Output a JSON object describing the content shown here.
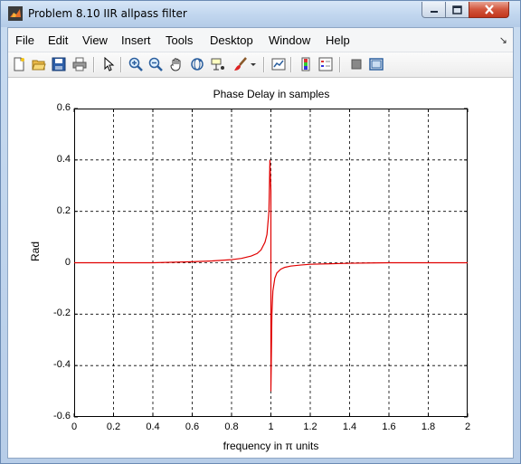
{
  "window": {
    "title": "Problem 8.10 IIR allpass filter"
  },
  "menubar": {
    "items": [
      "File",
      "Edit",
      "View",
      "Insert",
      "Tools",
      "Desktop",
      "Window",
      "Help"
    ],
    "overflow_arrow": "↘"
  },
  "toolbar": {
    "buttons": [
      {
        "name": "new-figure-icon"
      },
      {
        "name": "open-file-icon"
      },
      {
        "name": "save-figure-icon"
      },
      {
        "name": "print-figure-icon"
      },
      {
        "name": "edit-plot-arrow-icon"
      },
      {
        "name": "zoom-in-icon"
      },
      {
        "name": "zoom-out-icon"
      },
      {
        "name": "pan-hand-icon"
      },
      {
        "name": "rotate-3d-icon"
      },
      {
        "name": "data-cursor-icon"
      },
      {
        "name": "brush-icon"
      },
      {
        "name": "brush-dropdown-icon"
      },
      {
        "name": "link-plot-icon"
      },
      {
        "name": "colorbar-icon"
      },
      {
        "name": "legend-icon"
      },
      {
        "name": "hide-plot-tools-icon"
      },
      {
        "name": "show-plot-tools-icon"
      }
    ]
  },
  "colors": {
    "plot_line": "#e00000",
    "grid": "#000000",
    "titlebar": "#c2d7ef",
    "close_button": "#c2361c"
  },
  "chart_data": {
    "type": "line",
    "title": "Phase Delay in samples",
    "xlabel": "frequency in π units",
    "ylabel": "Rad",
    "xlim": [
      0,
      2
    ],
    "ylim": [
      -0.6,
      0.6
    ],
    "xticks": [
      "0",
      "0.2",
      "0.4",
      "0.6",
      "0.8",
      "1",
      "1.2",
      "1.4",
      "1.6",
      "1.8",
      "2"
    ],
    "yticks": [
      "0.6",
      "0.4",
      "0.2",
      "0",
      "-0.2",
      "-0.4",
      "-0.6"
    ],
    "grid": true,
    "series": [
      {
        "color": "#e00000",
        "x": [
          0,
          0.4,
          0.6,
          0.7,
          0.8,
          0.85,
          0.9,
          0.93,
          0.95,
          0.97,
          0.98,
          0.99,
          0.995,
          1.0,
          1.0,
          1.005,
          1.01,
          1.02,
          1.03,
          1.05,
          1.07,
          1.1,
          1.15,
          1.2,
          1.3,
          1.4,
          1.5,
          1.6,
          2.0
        ],
        "y": [
          0,
          0.0,
          0.004,
          0.007,
          0.012,
          0.017,
          0.026,
          0.036,
          0.05,
          0.08,
          0.11,
          0.2,
          0.4,
          0.28,
          -0.5,
          -0.2,
          -0.11,
          -0.06,
          -0.04,
          -0.025,
          -0.018,
          -0.013,
          -0.009,
          -0.006,
          -0.004,
          -0.002,
          -0.001,
          0,
          0
        ]
      }
    ]
  }
}
